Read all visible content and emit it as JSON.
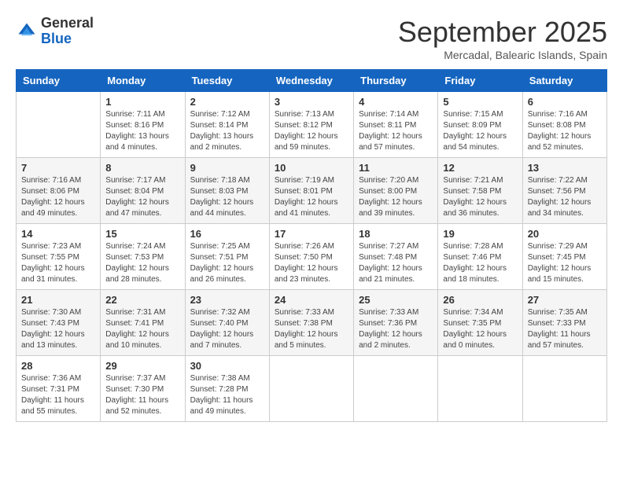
{
  "header": {
    "logo_general": "General",
    "logo_blue": "Blue",
    "month_title": "September 2025",
    "location": "Mercadal, Balearic Islands, Spain"
  },
  "days_of_week": [
    "Sunday",
    "Monday",
    "Tuesday",
    "Wednesday",
    "Thursday",
    "Friday",
    "Saturday"
  ],
  "weeks": [
    [
      {
        "day": "",
        "info": ""
      },
      {
        "day": "1",
        "info": "Sunrise: 7:11 AM\nSunset: 8:16 PM\nDaylight: 13 hours\nand 4 minutes."
      },
      {
        "day": "2",
        "info": "Sunrise: 7:12 AM\nSunset: 8:14 PM\nDaylight: 13 hours\nand 2 minutes."
      },
      {
        "day": "3",
        "info": "Sunrise: 7:13 AM\nSunset: 8:12 PM\nDaylight: 12 hours\nand 59 minutes."
      },
      {
        "day": "4",
        "info": "Sunrise: 7:14 AM\nSunset: 8:11 PM\nDaylight: 12 hours\nand 57 minutes."
      },
      {
        "day": "5",
        "info": "Sunrise: 7:15 AM\nSunset: 8:09 PM\nDaylight: 12 hours\nand 54 minutes."
      },
      {
        "day": "6",
        "info": "Sunrise: 7:16 AM\nSunset: 8:08 PM\nDaylight: 12 hours\nand 52 minutes."
      }
    ],
    [
      {
        "day": "7",
        "info": "Sunrise: 7:16 AM\nSunset: 8:06 PM\nDaylight: 12 hours\nand 49 minutes."
      },
      {
        "day": "8",
        "info": "Sunrise: 7:17 AM\nSunset: 8:04 PM\nDaylight: 12 hours\nand 47 minutes."
      },
      {
        "day": "9",
        "info": "Sunrise: 7:18 AM\nSunset: 8:03 PM\nDaylight: 12 hours\nand 44 minutes."
      },
      {
        "day": "10",
        "info": "Sunrise: 7:19 AM\nSunset: 8:01 PM\nDaylight: 12 hours\nand 41 minutes."
      },
      {
        "day": "11",
        "info": "Sunrise: 7:20 AM\nSunset: 8:00 PM\nDaylight: 12 hours\nand 39 minutes."
      },
      {
        "day": "12",
        "info": "Sunrise: 7:21 AM\nSunset: 7:58 PM\nDaylight: 12 hours\nand 36 minutes."
      },
      {
        "day": "13",
        "info": "Sunrise: 7:22 AM\nSunset: 7:56 PM\nDaylight: 12 hours\nand 34 minutes."
      }
    ],
    [
      {
        "day": "14",
        "info": "Sunrise: 7:23 AM\nSunset: 7:55 PM\nDaylight: 12 hours\nand 31 minutes."
      },
      {
        "day": "15",
        "info": "Sunrise: 7:24 AM\nSunset: 7:53 PM\nDaylight: 12 hours\nand 28 minutes."
      },
      {
        "day": "16",
        "info": "Sunrise: 7:25 AM\nSunset: 7:51 PM\nDaylight: 12 hours\nand 26 minutes."
      },
      {
        "day": "17",
        "info": "Sunrise: 7:26 AM\nSunset: 7:50 PM\nDaylight: 12 hours\nand 23 minutes."
      },
      {
        "day": "18",
        "info": "Sunrise: 7:27 AM\nSunset: 7:48 PM\nDaylight: 12 hours\nand 21 minutes."
      },
      {
        "day": "19",
        "info": "Sunrise: 7:28 AM\nSunset: 7:46 PM\nDaylight: 12 hours\nand 18 minutes."
      },
      {
        "day": "20",
        "info": "Sunrise: 7:29 AM\nSunset: 7:45 PM\nDaylight: 12 hours\nand 15 minutes."
      }
    ],
    [
      {
        "day": "21",
        "info": "Sunrise: 7:30 AM\nSunset: 7:43 PM\nDaylight: 12 hours\nand 13 minutes."
      },
      {
        "day": "22",
        "info": "Sunrise: 7:31 AM\nSunset: 7:41 PM\nDaylight: 12 hours\nand 10 minutes."
      },
      {
        "day": "23",
        "info": "Sunrise: 7:32 AM\nSunset: 7:40 PM\nDaylight: 12 hours\nand 7 minutes."
      },
      {
        "day": "24",
        "info": "Sunrise: 7:33 AM\nSunset: 7:38 PM\nDaylight: 12 hours\nand 5 minutes."
      },
      {
        "day": "25",
        "info": "Sunrise: 7:33 AM\nSunset: 7:36 PM\nDaylight: 12 hours\nand 2 minutes."
      },
      {
        "day": "26",
        "info": "Sunrise: 7:34 AM\nSunset: 7:35 PM\nDaylight: 12 hours\nand 0 minutes."
      },
      {
        "day": "27",
        "info": "Sunrise: 7:35 AM\nSunset: 7:33 PM\nDaylight: 11 hours\nand 57 minutes."
      }
    ],
    [
      {
        "day": "28",
        "info": "Sunrise: 7:36 AM\nSunset: 7:31 PM\nDaylight: 11 hours\nand 55 minutes."
      },
      {
        "day": "29",
        "info": "Sunrise: 7:37 AM\nSunset: 7:30 PM\nDaylight: 11 hours\nand 52 minutes."
      },
      {
        "day": "30",
        "info": "Sunrise: 7:38 AM\nSunset: 7:28 PM\nDaylight: 11 hours\nand 49 minutes."
      },
      {
        "day": "",
        "info": ""
      },
      {
        "day": "",
        "info": ""
      },
      {
        "day": "",
        "info": ""
      },
      {
        "day": "",
        "info": ""
      }
    ]
  ]
}
